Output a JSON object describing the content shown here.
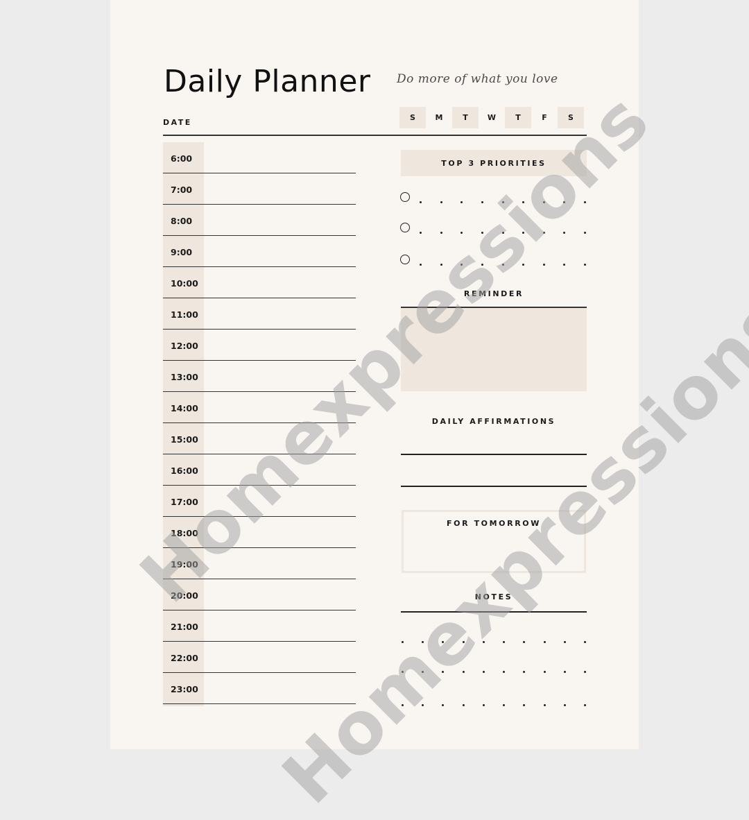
{
  "header": {
    "title": "Daily Planner",
    "quote": "Do more of what you love",
    "date_label": "DATE"
  },
  "weekdays": [
    {
      "label": "S",
      "shaded": true
    },
    {
      "label": "M",
      "shaded": false
    },
    {
      "label": "T",
      "shaded": true
    },
    {
      "label": "W",
      "shaded": false
    },
    {
      "label": "T",
      "shaded": true
    },
    {
      "label": "F",
      "shaded": false
    },
    {
      "label": "S",
      "shaded": true
    }
  ],
  "schedule": {
    "hours": [
      "6:00",
      "7:00",
      "8:00",
      "9:00",
      "10:00",
      "11:00",
      "12:00",
      "13:00",
      "14:00",
      "15:00",
      "16:00",
      "17:00",
      "18:00",
      "19:00",
      "20:00",
      "21:00",
      "22:00",
      "23:00"
    ]
  },
  "sections": {
    "priorities": {
      "title": "TOP 3 PRIORITIES",
      "count": 3
    },
    "reminder": {
      "title": "REMINDER"
    },
    "affirmations": {
      "title": "DAILY AFFIRMATIONS",
      "lines": 2
    },
    "tomorrow": {
      "title": "FOR TOMORROW"
    },
    "notes": {
      "title": "NOTES",
      "rows": 3
    }
  },
  "watermark": {
    "text": "Homexpressions"
  },
  "colors": {
    "page": "#f9f6f2",
    "background": "#ececec",
    "accent_beige": "#efe7de",
    "ink": "#1a1a1a"
  }
}
